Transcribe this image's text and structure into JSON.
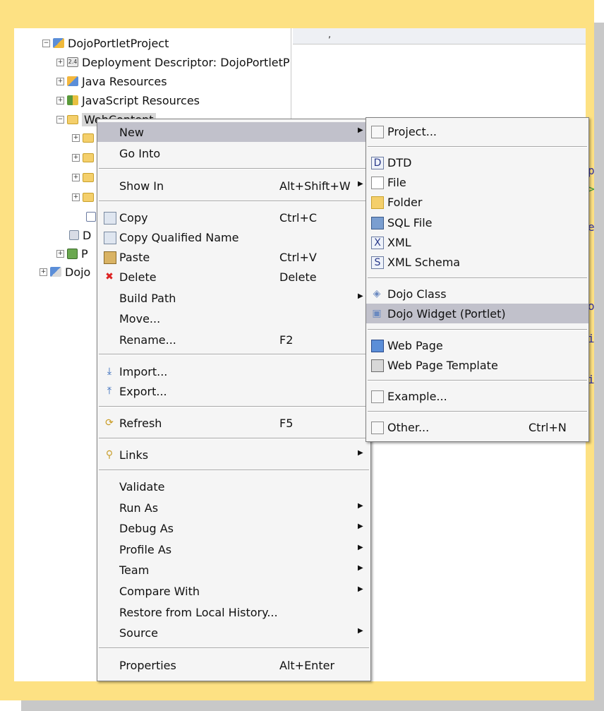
{
  "tree": {
    "items": [
      {
        "label": "DojoPortletProject",
        "expander": "⊟"
      },
      {
        "label": "Deployment Descriptor: DojoPortletP",
        "expander": "⊞",
        "icon_text": "2.4"
      },
      {
        "label": "Java Resources",
        "expander": "⊞"
      },
      {
        "label": "JavaScript Resources",
        "expander": "⊞"
      },
      {
        "label": "WebContent",
        "expander": "⊟"
      },
      {
        "label": "D",
        "expander": ""
      },
      {
        "label": "P",
        "expander": "⊞"
      },
      {
        "label": "Dojo",
        "expander": "⊞"
      }
    ]
  },
  "context_menu": {
    "items": [
      {
        "label": "New",
        "has_submenu": true,
        "highlighted": true
      },
      {
        "label": "Go Into"
      },
      {
        "label": "Show In",
        "accelerator": "Alt+Shift+W",
        "has_submenu": true
      },
      {
        "label": "Copy",
        "accelerator": "Ctrl+C",
        "icon": "copy-icon"
      },
      {
        "label": "Copy Qualified Name",
        "icon": "copy-qualified-name-icon"
      },
      {
        "label": "Paste",
        "accelerator": "Ctrl+V",
        "icon": "paste-icon"
      },
      {
        "label": "Delete",
        "accelerator": "Delete",
        "icon": "delete-icon"
      },
      {
        "label": "Build Path",
        "has_submenu": true
      },
      {
        "label": "Move..."
      },
      {
        "label": "Rename...",
        "accelerator": "F2"
      },
      {
        "label": "Import...",
        "icon": "import-icon"
      },
      {
        "label": "Export...",
        "icon": "export-icon"
      },
      {
        "label": "Refresh",
        "accelerator": "F5",
        "icon": "refresh-icon"
      },
      {
        "label": "Links",
        "has_submenu": true,
        "icon": "links-icon"
      },
      {
        "label": "Validate"
      },
      {
        "label": "Run As",
        "has_submenu": true
      },
      {
        "label": "Debug As",
        "has_submenu": true
      },
      {
        "label": "Profile As",
        "has_submenu": true
      },
      {
        "label": "Team",
        "has_submenu": true
      },
      {
        "label": "Compare With",
        "has_submenu": true
      },
      {
        "label": "Restore from Local History..."
      },
      {
        "label": "Source",
        "has_submenu": true
      },
      {
        "label": "Properties",
        "accelerator": "Alt+Enter"
      }
    ]
  },
  "submenu_new": {
    "items": [
      {
        "label": "Project...",
        "icon": "project-icon"
      },
      {
        "label": "DTD",
        "icon": "dtd-icon"
      },
      {
        "label": "File",
        "icon": "file-icon"
      },
      {
        "label": "Folder",
        "icon": "folder-icon"
      },
      {
        "label": "SQL File",
        "icon": "sql-file-icon"
      },
      {
        "label": "XML",
        "icon": "xml-icon"
      },
      {
        "label": "XML Schema",
        "icon": "xml-schema-icon"
      },
      {
        "label": "Dojo Class",
        "icon": "dojo-class-icon"
      },
      {
        "label": "Dojo Widget (Portlet)",
        "icon": "dojo-widget-icon",
        "highlighted": true
      },
      {
        "label": "Web Page",
        "icon": "web-page-icon"
      },
      {
        "label": "Web Page Template",
        "icon": "web-page-template-icon"
      },
      {
        "label": "Example...",
        "icon": "example-icon"
      },
      {
        "label": "Other...",
        "accelerator": "Ctrl+N",
        "icon": "other-icon"
      }
    ]
  },
  "colors": {
    "frame": "#fde183",
    "menu_background": "#f5f5f5",
    "highlight": "#c1c1cb"
  }
}
